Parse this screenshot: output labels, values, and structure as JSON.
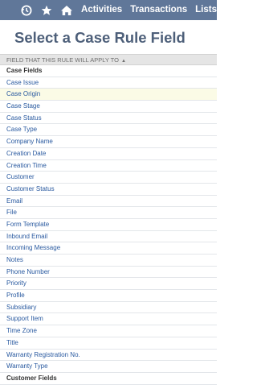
{
  "nav": {
    "icons": [
      "recent-icon",
      "star-icon",
      "home-icon"
    ],
    "links": [
      "Activities",
      "Transactions",
      "Lists"
    ]
  },
  "page": {
    "title": "Select a Case Rule Field"
  },
  "table": {
    "column_header": "FIELD THAT THIS RULE WILL APPLY TO",
    "sort_indicator": "▲",
    "groups": [
      {
        "label": "Case Fields",
        "items": [
          "Case Issue",
          "Case Origin",
          "Case Stage",
          "Case Status",
          "Case Type",
          "Company Name",
          "Creation Date",
          "Creation Time",
          "Customer",
          "Customer Status",
          "Email",
          "File",
          "Form Template",
          "Inbound Email",
          "Incoming Message",
          "Notes",
          "Phone Number",
          "Priority",
          "Profile",
          "Subsidiary",
          "Support Item",
          "Time Zone",
          "Title",
          "Warranty Registration No.",
          "Warranty Type"
        ]
      },
      {
        "label": "Customer Fields",
        "items": []
      }
    ]
  },
  "colors": {
    "navbar": "#607799",
    "title": "#4d5f79",
    "link": "#2a5aa0",
    "highlight_row": "#fbfbe6"
  }
}
